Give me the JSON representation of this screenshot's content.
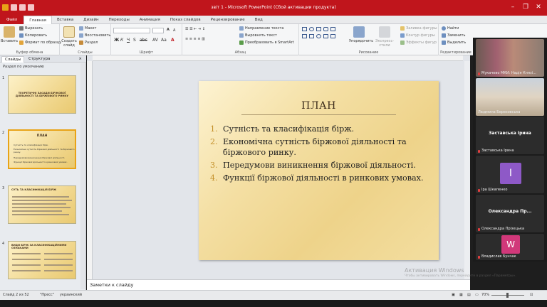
{
  "window": {
    "title": "звіт 1 - Microsoft PowerPoint (Сбой активации продукта)",
    "controls": [
      "–",
      "❐",
      "✕"
    ]
  },
  "ribbon_tabs": [
    "Файл",
    "Главная",
    "Вставка",
    "Дизайн",
    "Переходы",
    "Анимация",
    "Показ слайдов",
    "Рецензирование",
    "Вид"
  ],
  "ribbon": {
    "clipboard": {
      "paste": "Вставить",
      "cut": "Вырезать",
      "copy": "Копировать",
      "format_painter": "Формат по образцу",
      "label": "Буфер обмена"
    },
    "slides": {
      "create": "Создать слайд",
      "layout": "Макет",
      "reset": "Восстановить",
      "section": "Раздел",
      "label": "Слайды"
    },
    "font": {
      "label": "Шрифт"
    },
    "paragraph": {
      "text_direction": "Направление текста",
      "align_text": "Выровнять текст",
      "smartart": "Преобразовать в SmartArt",
      "label": "Абзац"
    },
    "drawing": {
      "arrange": "Упорядочить",
      "quick_styles": "Экспресс-стили",
      "fill": "Заливка фигуры",
      "outline": "Контур фигуры",
      "effects": "Эффекты фигур",
      "label": "Рисование"
    },
    "editing": {
      "find": "Найти",
      "replace": "Заменить",
      "select": "Выделить",
      "label": "Редактирование"
    }
  },
  "left_pane": {
    "tabs": [
      "Слайды",
      "Структура"
    ],
    "close": "×",
    "section": "Раздел по умолчанию",
    "thumbnails": [
      {
        "num": "1",
        "title": "ТЕОРЕТИЧНІ ЗАСАДИ БІРЖОВОЇ ДІЯЛЬНОСТІ ТА БІРЖОВОГО РИНКУ"
      },
      {
        "num": "2",
        "title": "ПЛАН"
      },
      {
        "num": "3",
        "title": "СУТЬ ТА КЛАСИФІКАЦІЯ БІРЖ"
      },
      {
        "num": "4",
        "title": "ВИДИ БІРЖ ЗА КЛАСИФІКАЦІЙНИМИ ОЗНАКАМИ"
      }
    ]
  },
  "slide": {
    "title": "ПЛАН",
    "items": [
      {
        "num": "1.",
        "text": "Сутність та класифікація бірж."
      },
      {
        "num": "2.",
        "text": "Економічна сутність біржової діяльності та біржового ринку."
      },
      {
        "num": "3.",
        "text": "Передумови виникнення біржової діяльності."
      },
      {
        "num": "4.",
        "text": "Функції біржової діяльності в ринкових умовах."
      }
    ]
  },
  "notes": {
    "placeholder": "Заметки к слайду"
  },
  "status": {
    "slide_info": "Слайд 2 из 52",
    "theme": "\"Пресс\"",
    "language": "украинский",
    "zoom": "70%"
  },
  "watermark": {
    "line1": "Активация Windows",
    "line2": "Чтобы активировать Windows, перейдите в раздел «Параметры»."
  },
  "participants": [
    {
      "name": "Мукачево МКИ: Надія Князі...",
      "type": "video"
    },
    {
      "name": "Людмила Березовська",
      "type": "video"
    },
    {
      "name": "Заставська Ірина",
      "header": "Заставська Ірина",
      "type": "name"
    },
    {
      "name": "Іра Шкапенко",
      "initial": "І",
      "color": "#8e59c7",
      "type": "avatar"
    },
    {
      "name": "Олександра Прізецька",
      "header": "Олександра Пр...",
      "type": "name"
    },
    {
      "name": "Владислав Бунчак",
      "initial": "W",
      "color": "#d1387a",
      "type": "avatar"
    }
  ]
}
